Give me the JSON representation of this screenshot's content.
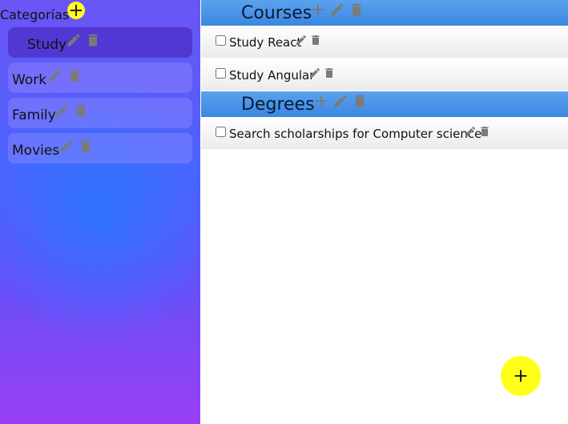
{
  "sidebar": {
    "title": "Categorías",
    "categories": [
      {
        "label": "Study",
        "active": true
      },
      {
        "label": "Work",
        "active": false
      },
      {
        "label": "Family",
        "active": false
      },
      {
        "label": "Movies",
        "active": false
      }
    ]
  },
  "groups": [
    {
      "title": "Courses",
      "tasks": [
        {
          "label": "Study React",
          "checked": false
        },
        {
          "label": "Study Angular",
          "checked": false
        }
      ]
    },
    {
      "title": "Degrees",
      "tasks": [
        {
          "label": "Search scholarships for Computer science",
          "checked": false
        }
      ]
    }
  ],
  "icons": {
    "add": "plus-icon",
    "edit": "pencil-icon",
    "delete": "trash-icon"
  },
  "colors": {
    "accent_yellow": "#ffff1a",
    "header_blue": "#4a94e8",
    "icon_gray": "#7a7a7a",
    "sidebar_blue": "#2f6dff",
    "sidebar_purple": "#9a3ff3"
  }
}
